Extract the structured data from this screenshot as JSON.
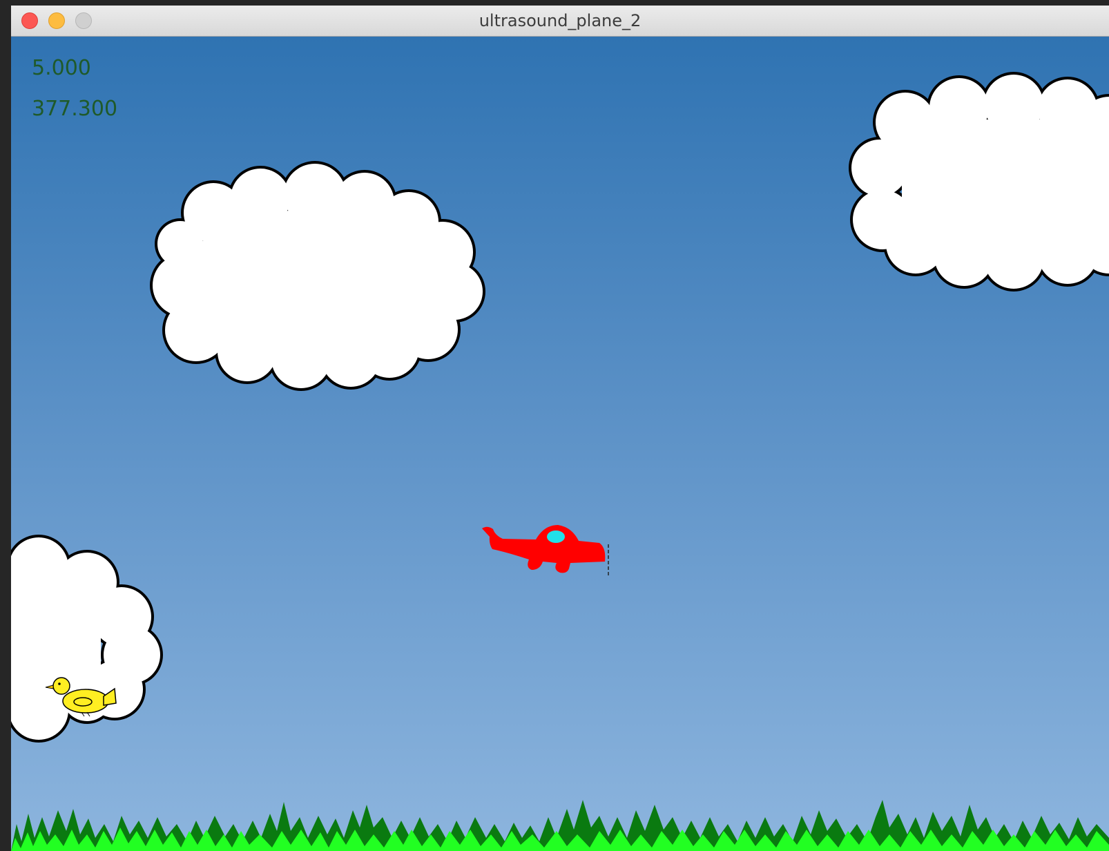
{
  "window": {
    "title": "ultrasound_plane_2"
  },
  "hud": {
    "value_1": "5.000",
    "value_2": "377.300"
  },
  "colors": {
    "sky_top": "#2f73b2",
    "sky_bottom": "#8db5de",
    "plane": "#ff0000",
    "cockpit": "#22e0e8",
    "bird": "#ffee22",
    "grass_dark": "#0a7a10",
    "grass_light": "#22ff22",
    "hud_text": "#1f5a2a"
  },
  "sprites": [
    "cloud",
    "cloud",
    "cloud",
    "red-plane",
    "yellow-bird",
    "grass"
  ]
}
